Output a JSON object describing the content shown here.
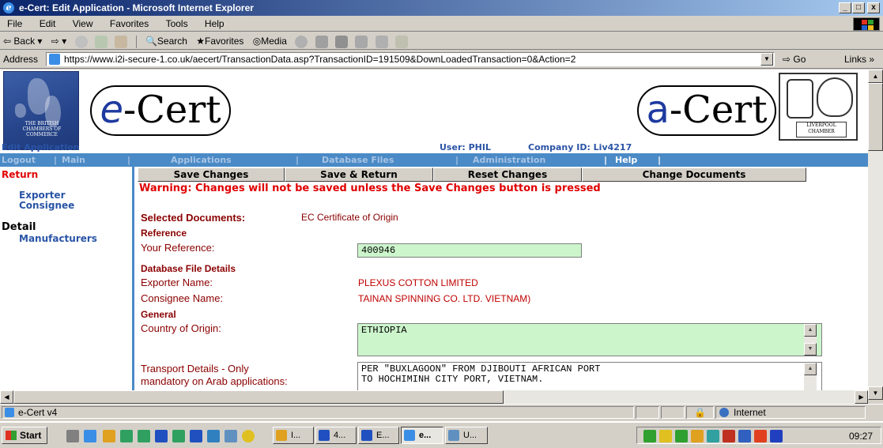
{
  "window": {
    "title": "e-Cert: Edit Application - Microsoft Internet Explorer",
    "min": "_",
    "max": "□",
    "close": "x"
  },
  "menu": [
    "File",
    "Edit",
    "View",
    "Favorites",
    "Tools",
    "Help"
  ],
  "toolbar": {
    "back": "Back",
    "search": "Search",
    "favorites": "Favorites",
    "media": "Media"
  },
  "address": {
    "label": "Address",
    "url": "https://www.i2i-secure-1.co.uk/aecert/TransactionData.asp?TransactionID=191509&DownLoadedTransaction=0&Action=2",
    "go": "Go",
    "links": "Links »"
  },
  "header": {
    "map_caption": "THE BRITISH CHAMBERS OF COMMERCE",
    "ecert_prefix": "e",
    "ecert_suffix": "-Cert",
    "acert_prefix": "a",
    "acert_suffix": "-Cert",
    "crest_caption": "LIVERPOOL CHAMBER"
  },
  "info": {
    "page_title": "Edit Application",
    "user": "User: PHIL",
    "company": "Company ID: Liv4217"
  },
  "nav": {
    "logout": "Logout",
    "sep1": "|",
    "main": "Main",
    "sep2": "|",
    "applications": "Applications",
    "sep3": "|",
    "database_files": "Database Files",
    "sep4": "|",
    "administration": "Administration",
    "sep5": "|",
    "help": "Help",
    "sep6": "|"
  },
  "sidebar": {
    "return": "Return",
    "exporter": "Exporter",
    "consignee": "Consignee",
    "detail": "Detail",
    "manufacturers": "Manufacturers"
  },
  "buttons": {
    "save": "Save Changes",
    "save_return": "Save & Return",
    "reset": "Reset Changes",
    "change_docs": "Change Documents"
  },
  "warning": "Warning: Changes will not be saved unless the Save Changes button is pressed",
  "form": {
    "selected_docs_label": "Selected Documents",
    "selected_docs_colon": ":",
    "selected_docs_value": "EC Certificate of Origin",
    "reference_heading": "Reference",
    "your_reference_label": "Your Reference:",
    "your_reference_value": "400946",
    "db_heading": "Database File Details",
    "exporter_name_label": "Exporter Name:",
    "exporter_name_value": "PLEXUS COTTON LIMITED",
    "consignee_name_label": "Consignee Name:",
    "consignee_name_value": "TAINAN SPINNING CO. LTD. VIETNAM)",
    "general_heading": "General",
    "country_label": "Country of Origin:",
    "country_value": "ETHIOPIA",
    "transport_label_1": "Transport Details - Only",
    "transport_label_2": "mandatory on Arab applications:",
    "transport_value": "PER \"BUXLAGOON\" FROM DJIBOUTI AFRICAN PORT\nTO HOCHIMINH CITY PORT, VIETNAM."
  },
  "status": {
    "text": "e-Cert v4",
    "zone": "Internet"
  },
  "taskbar": {
    "start": "Start",
    "tasks": [
      "I...",
      "4...",
      "E...",
      "e...",
      "U..."
    ],
    "clock": "09:27"
  },
  "colors": {
    "nav_blue": "#4a8ac6",
    "link_blue": "#2a54a6",
    "label_red": "#8b0000",
    "warn_red": "#e00000",
    "field_green": "#ccf5cc"
  }
}
